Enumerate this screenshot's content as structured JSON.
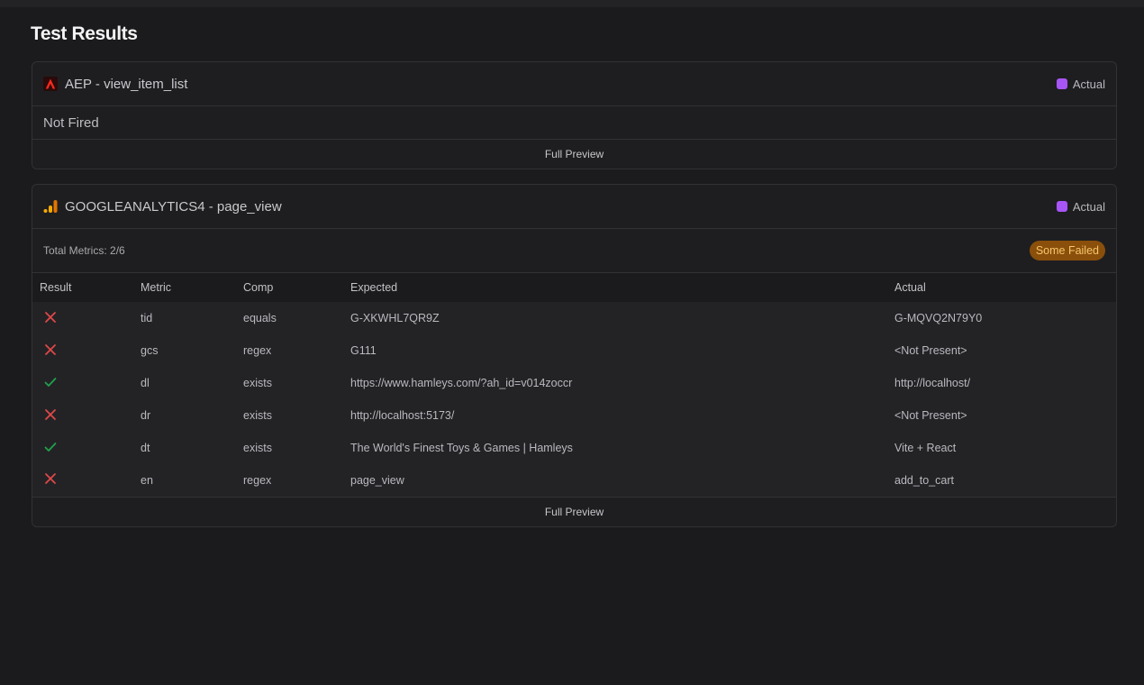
{
  "page": {
    "title": "Test Results"
  },
  "colors": {
    "legend_actual": "#a855f7",
    "fail": "#e04848",
    "pass": "#22a04a",
    "badge_bg": "#8a4f0b",
    "badge_text": "#f6c56a"
  },
  "cards": [
    {
      "icon": "adobe-icon",
      "title": "AEP - view_item_list",
      "legend": "Actual",
      "status": "Not Fired",
      "footer": "Full Preview"
    },
    {
      "icon": "google-analytics-icon",
      "title": "GOOGLEANALYTICS4 - page_view",
      "legend": "Actual",
      "summary": "Total Metrics: 2/6",
      "badge": "Some Failed",
      "columns": [
        "Result",
        "Metric",
        "Comp",
        "Expected",
        "Actual"
      ],
      "rows": [
        {
          "result": "fail",
          "metric": "tid",
          "comp": "equals",
          "expected": "G-XKWHL7QR9Z",
          "actual": "G-MQVQ2N79Y0"
        },
        {
          "result": "fail",
          "metric": "gcs",
          "comp": "regex",
          "expected": "G111",
          "actual": "<Not Present>"
        },
        {
          "result": "pass",
          "metric": "dl",
          "comp": "exists",
          "expected": "https://www.hamleys.com/?ah_id=v014zoccr",
          "actual": "http://localhost/"
        },
        {
          "result": "fail",
          "metric": "dr",
          "comp": "exists",
          "expected": "http://localhost:5173/",
          "actual": "<Not Present>"
        },
        {
          "result": "pass",
          "metric": "dt",
          "comp": "exists",
          "expected": "The World's Finest Toys & Games | Hamleys",
          "actual": "Vite + React"
        },
        {
          "result": "fail",
          "metric": "en",
          "comp": "regex",
          "expected": "page_view",
          "actual": "add_to_cart"
        }
      ],
      "footer": "Full Preview"
    }
  ]
}
